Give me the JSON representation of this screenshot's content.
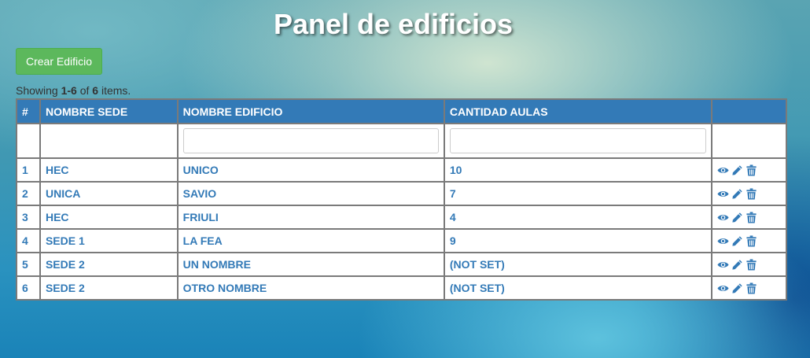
{
  "page": {
    "title": "Panel de edificios"
  },
  "toolbar": {
    "create_label": "Crear Edificio"
  },
  "summary": {
    "prefix": "Showing ",
    "range": "1-6",
    "of": " of ",
    "total": "6",
    "suffix": " items."
  },
  "table": {
    "headers": {
      "num": "#",
      "sede": "NOMBRE SEDE",
      "edificio": "NOMBRE EDIFICIO",
      "aulas": "CANTIDAD AULAS"
    },
    "rows": [
      {
        "num": "1",
        "sede": "HEC",
        "edificio": "UNICO",
        "aulas": "10"
      },
      {
        "num": "2",
        "sede": "UNICA",
        "edificio": "SAVIO",
        "aulas": "7"
      },
      {
        "num": "3",
        "sede": "HEC",
        "edificio": "FRIULI",
        "aulas": "4"
      },
      {
        "num": "4",
        "sede": "SEDE 1",
        "edificio": "LA FEA",
        "aulas": "9"
      },
      {
        "num": "5",
        "sede": "SEDE 2",
        "edificio": "UN NOMBRE",
        "aulas": "(NOT SET)"
      },
      {
        "num": "6",
        "sede": "SEDE 2",
        "edificio": "OTRO NOMBRE",
        "aulas": "(NOT SET)"
      }
    ],
    "actions": [
      "eye-icon",
      "pencil-icon",
      "trash-icon"
    ]
  },
  "colors": {
    "header_bg": "#337ab7",
    "link": "#337ab7",
    "create_button": "#5cb85c"
  }
}
